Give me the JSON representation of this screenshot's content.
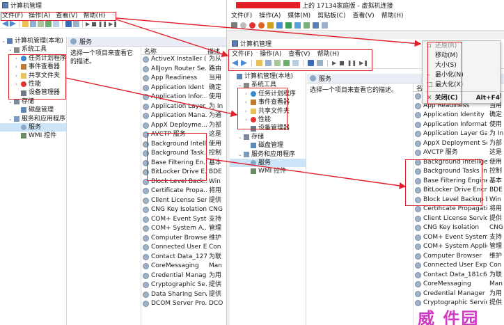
{
  "left": {
    "title": "计算机管理",
    "menu": [
      "文件(F)",
      "操作(A)",
      "查看(V)",
      "帮助(H)"
    ],
    "tree": [
      {
        "label": "计算机管理(本地)",
        "level": 0,
        "arrow": "⌄",
        "icon": "computer-icon"
      },
      {
        "label": "系统工具",
        "level": 1,
        "arrow": "⌄",
        "icon": "tools-icon"
      },
      {
        "label": "任务计划程序",
        "level": 2,
        "arrow": "›",
        "icon": "clock-icon"
      },
      {
        "label": "事件查看器",
        "level": 2,
        "arrow": "›",
        "icon": "event-icon"
      },
      {
        "label": "共享文件夹",
        "level": 2,
        "arrow": "›",
        "icon": "folder-icon"
      },
      {
        "label": "性能",
        "level": 2,
        "arrow": "›",
        "icon": "no-icon"
      },
      {
        "label": "设备管理器",
        "level": 2,
        "arrow": "",
        "icon": "device-icon"
      },
      {
        "label": "存储",
        "level": 1,
        "arrow": "⌄",
        "icon": "storage-icon"
      },
      {
        "label": "磁盘管理",
        "level": 2,
        "arrow": "",
        "icon": "disk-icon"
      },
      {
        "label": "服务和应用程序",
        "level": 1,
        "arrow": "⌄",
        "icon": "apps-icon"
      },
      {
        "label": "服务",
        "level": 2,
        "arrow": "",
        "icon": "gear-icon",
        "selected": true
      },
      {
        "label": "WMI 控件",
        "level": 2,
        "arrow": "",
        "icon": "wmi-icon"
      }
    ],
    "services_header": "服务",
    "description": "选择一个项目来查看它的描述。",
    "col_name": "名称",
    "col_desc": "描述",
    "rows": [
      {
        "name": "ActiveX Installer (...",
        "desc": "为从"
      },
      {
        "name": "AllJoyn Router Se...",
        "desc": "路由"
      },
      {
        "name": "App Readiness",
        "desc": "当用"
      },
      {
        "name": "Application Ident",
        "desc": "确定"
      },
      {
        "name": "Application Infor...",
        "desc": "使用"
      },
      {
        "name": "Application Layer...",
        "desc": "为 In"
      },
      {
        "name": "Application Mana...",
        "desc": "为通"
      },
      {
        "name": "AppX Deployme...",
        "desc": "为部"
      },
      {
        "name": "AVCTP 服务",
        "desc": "这是"
      },
      {
        "name": "Background Intell...",
        "desc": "使用"
      },
      {
        "name": "Background Task...",
        "desc": "控制"
      },
      {
        "name": "Base Filtering En...",
        "desc": "基本"
      },
      {
        "name": "BitLocker Drive E...",
        "desc": "BDE"
      },
      {
        "name": "Block Level Back...",
        "desc": "Win"
      },
      {
        "name": "Certificate Propa...",
        "desc": "将用"
      },
      {
        "name": "Client License Ser...",
        "desc": "提供"
      },
      {
        "name": "CNG Key Isolation",
        "desc": "CNG"
      },
      {
        "name": "COM+ Event Syst",
        "desc": "支持"
      },
      {
        "name": "COM+ System A...",
        "desc": "管理"
      },
      {
        "name": "Computer Browser",
        "desc": "维护"
      },
      {
        "name": "Connected User E...",
        "desc": "Con"
      },
      {
        "name": "Contact Data_127",
        "desc": "为联"
      },
      {
        "name": "CoreMessaging",
        "desc": "Man"
      },
      {
        "name": "Credential Manag",
        "desc": "为用"
      },
      {
        "name": "Cryptographic Se...",
        "desc": "提供"
      },
      {
        "name": "Data Sharing Serv",
        "desc": "提供"
      },
      {
        "name": "DCOM Server Pro...",
        "desc": "DCO"
      }
    ]
  },
  "right": {
    "title_suffix": "上的 17134家庭版 - 虚拟机连接",
    "menu": [
      "文件(F)",
      "操作(A)",
      "媒体(M)",
      "剪贴板(C)",
      "查看(V)",
      "帮助(H)"
    ],
    "inner_title": "计算机管理",
    "inner_menu": [
      "文件(F)",
      "操作(A)",
      "查看(V)",
      "帮助(H)"
    ],
    "tree": [
      {
        "label": "计算机管理(本地)",
        "level": 0,
        "arrow": "",
        "icon": "computer-icon"
      },
      {
        "label": "系统工具",
        "level": 1,
        "arrow": "⌄",
        "icon": "tools-icon"
      },
      {
        "label": "任务计划程序",
        "level": 2,
        "arrow": "›",
        "icon": "clock-icon"
      },
      {
        "label": "事件查看器",
        "level": 2,
        "arrow": "›",
        "icon": "event-icon"
      },
      {
        "label": "共享文件夹",
        "level": 2,
        "arrow": "›",
        "icon": "folder-icon"
      },
      {
        "label": "性能",
        "level": 2,
        "arrow": "›",
        "icon": "no-icon"
      },
      {
        "label": "设备管理器",
        "level": 2,
        "arrow": "",
        "icon": "device-icon"
      },
      {
        "label": "存储",
        "level": 1,
        "arrow": "⌄",
        "icon": "storage-icon"
      },
      {
        "label": "磁盘管理",
        "level": 2,
        "arrow": "",
        "icon": "disk-icon"
      },
      {
        "label": "服务和应用程序",
        "level": 1,
        "arrow": "⌄",
        "icon": "apps-icon"
      },
      {
        "label": "服务",
        "level": 2,
        "arrow": "",
        "icon": "gear-icon",
        "selected": true
      },
      {
        "label": "WMI 控件",
        "level": 2,
        "arrow": "",
        "icon": "wmi-icon"
      }
    ],
    "services_header": "服务",
    "description": "选择一个项目来查看它的描述。",
    "col_name": "名",
    "col_desc": "述",
    "rows": [
      {
        "name": "AllJoyn Router Service",
        "desc": "路由"
      },
      {
        "name": "App Readiness",
        "desc": "当用"
      },
      {
        "name": "Application Identity",
        "desc": "确定"
      },
      {
        "name": "Application Information",
        "desc": "使用"
      },
      {
        "name": "Application Layer Gateway ...",
        "desc": "为 In"
      },
      {
        "name": "AppX Deployment Service ...",
        "desc": "为部"
      },
      {
        "name": "AVCTP 服务",
        "desc": "这是"
      },
      {
        "name": "Background Intelligent Tra...",
        "desc": "使用"
      },
      {
        "name": "Background Tasks Infrastru...",
        "desc": "控制"
      },
      {
        "name": "Base Filtering Engine",
        "desc": "基本"
      },
      {
        "name": "BitLocker Drive Encryption ...",
        "desc": "BDE"
      },
      {
        "name": "Block Level Backup Engine ...",
        "desc": "Win"
      },
      {
        "name": "Certificate Propagation",
        "desc": "将用"
      },
      {
        "name": "Client License Service (Clip...",
        "desc": "提供"
      },
      {
        "name": "CNG Key Isolation",
        "desc": "CNG"
      },
      {
        "name": "COM+ Event System",
        "desc": "支持"
      },
      {
        "name": "COM+ System Application",
        "desc": "管理"
      },
      {
        "name": "Computer Browser",
        "desc": "维护"
      },
      {
        "name": "Connected User Experienc...",
        "desc": "Con"
      },
      {
        "name": "Contact Data_181c6e",
        "desc": "为联"
      },
      {
        "name": "CoreMessaging",
        "desc": "Man"
      },
      {
        "name": "Credential Manager",
        "desc": "为用"
      },
      {
        "name": "Cryptographic Services",
        "desc": "提供"
      }
    ],
    "context_menu": [
      {
        "mark": "▫",
        "label": "还原(R)",
        "shortcut": "",
        "disabled": true
      },
      {
        "mark": "",
        "label": "移动(M)",
        "shortcut": ""
      },
      {
        "mark": "",
        "label": "大小(S)",
        "shortcut": ""
      },
      {
        "mark": "–",
        "label": "最小化(N)",
        "shortcut": ""
      },
      {
        "mark": "□",
        "label": "最大化(X)",
        "shortcut": ""
      },
      {
        "mark": "✕",
        "label": "关闭(C)",
        "shortcut": "Alt+F4",
        "bold": true
      }
    ]
  },
  "watermark": "威 件园",
  "colors": {
    "annotation": "#e0202a",
    "selection": "#cce4f7",
    "redacted": "#e32028",
    "watermark": "#c51ab8"
  }
}
